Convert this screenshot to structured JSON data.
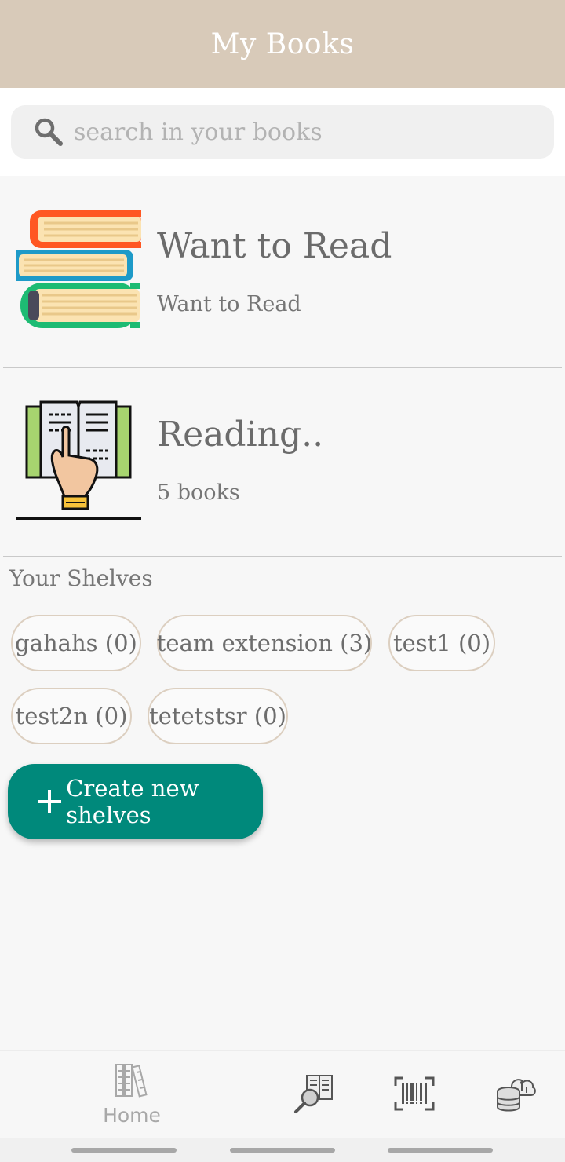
{
  "header": {
    "title": "My Books"
  },
  "search": {
    "placeholder": "search in your books"
  },
  "shelves": [
    {
      "title": "Want to Read",
      "subtitle": "Want to Read",
      "icon": "stacked-books-icon"
    },
    {
      "title": "Reading..",
      "subtitle": "5 books",
      "icon": "open-book-hand-icon"
    }
  ],
  "your_shelves": {
    "label": "Your Shelves",
    "chips": [
      "gahahs (0)",
      "team extension (3)",
      "test1 (0)",
      "test2n (0)",
      "tetetstsr (0)"
    ]
  },
  "create_button": {
    "label": "Create new shelves"
  },
  "bottom_nav": {
    "home_label": "Home",
    "items": [
      "books-shelf-icon",
      "book-search-icon",
      "barcode-scan-icon",
      "cloud-database-icon"
    ]
  },
  "colors": {
    "header": "#d8cab9",
    "accent": "#00897b",
    "chip_border": "#dccfc0"
  }
}
